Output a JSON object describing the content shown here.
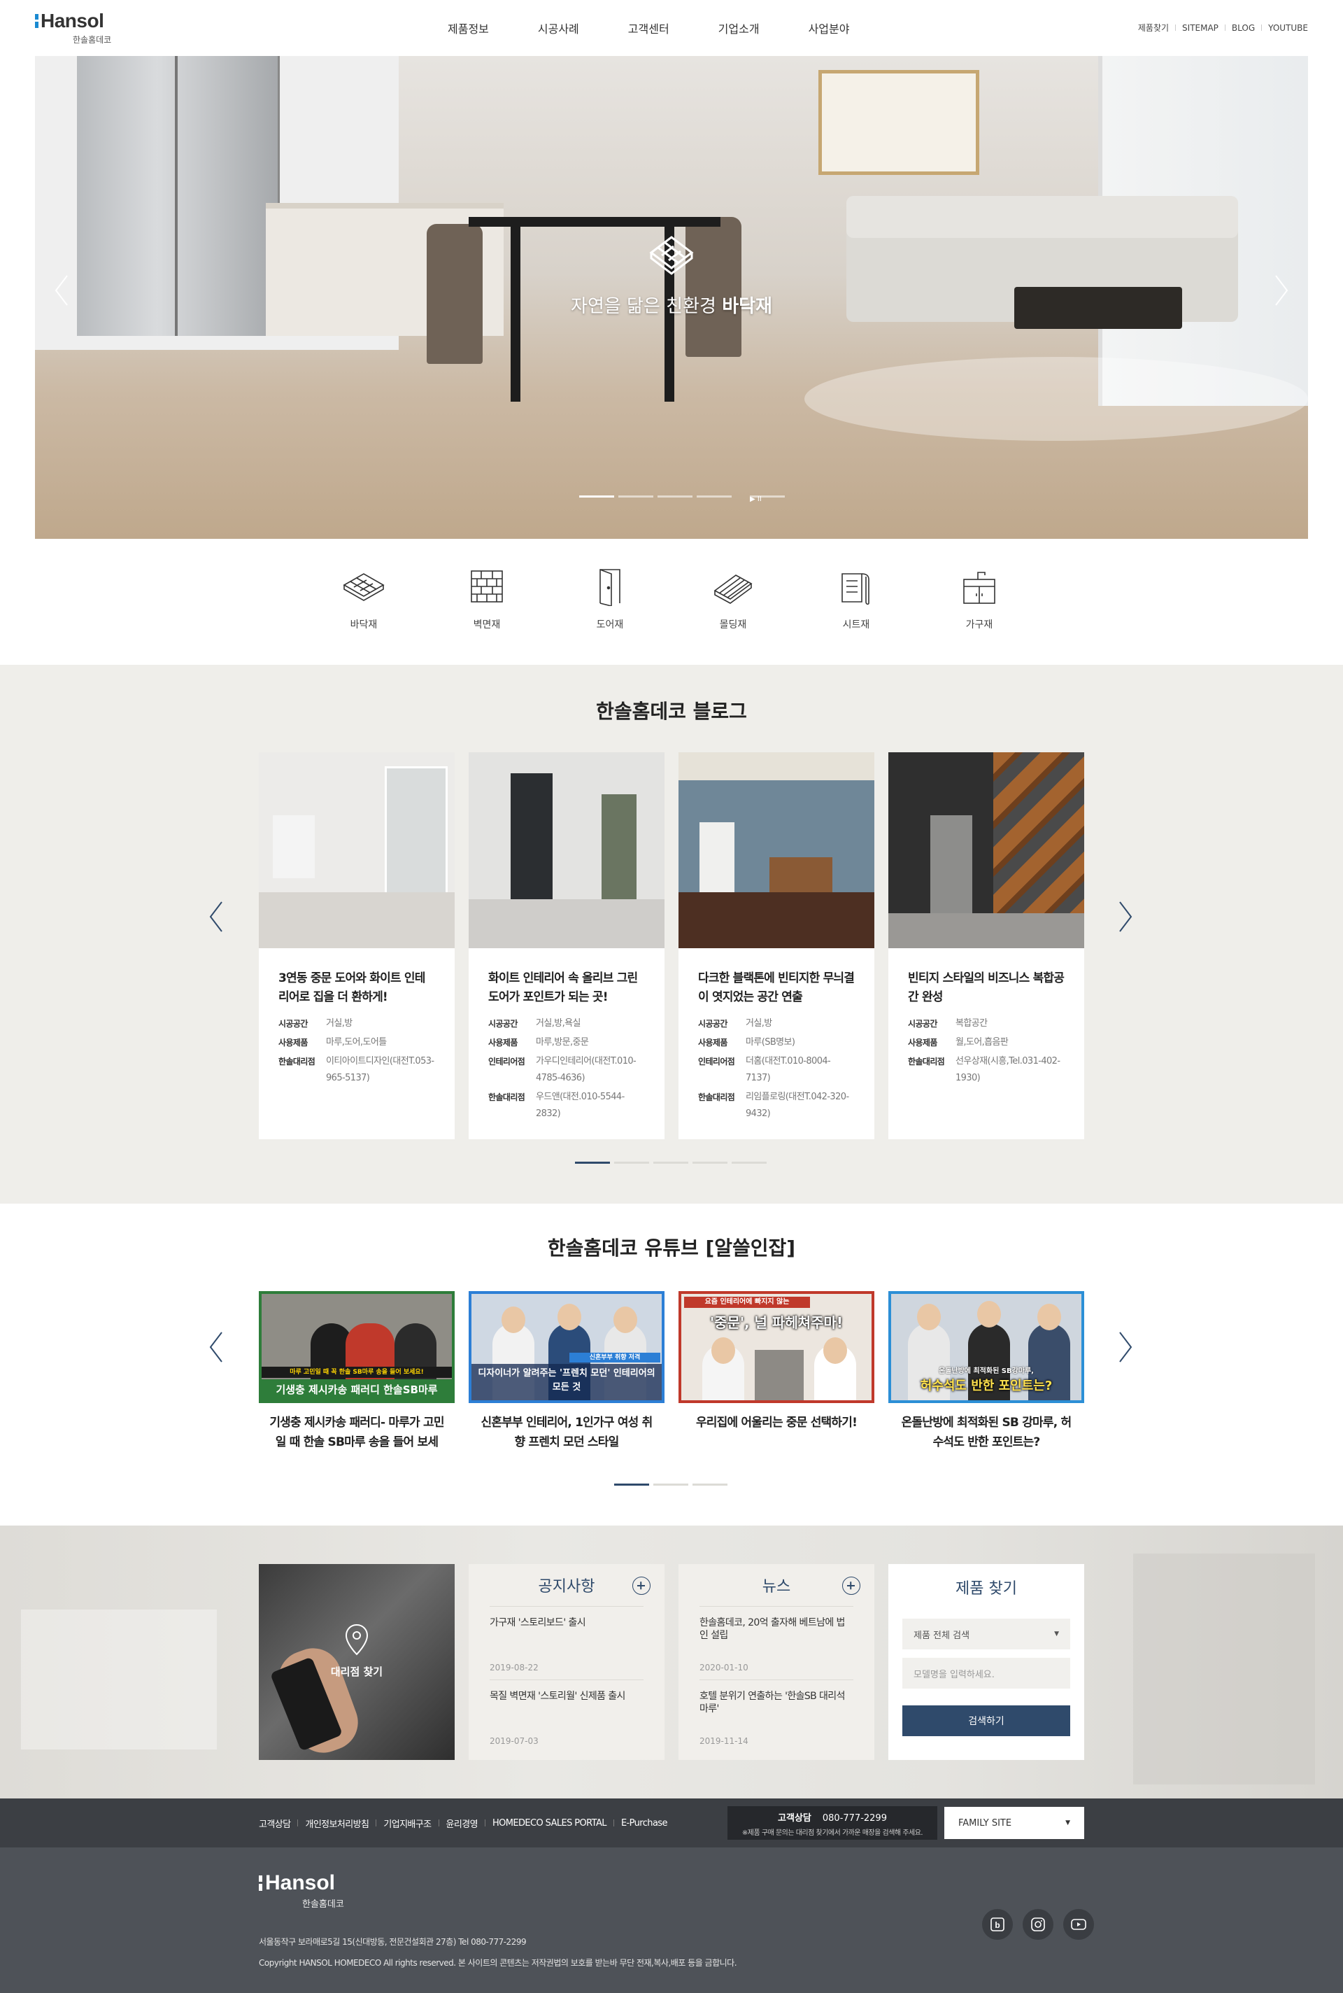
{
  "header": {
    "logo_text": "Hansol",
    "logo_sub": "한솔홈데코",
    "nav": [
      "제품정보",
      "시공사례",
      "고객센터",
      "기업소개",
      "사업분야"
    ],
    "util": [
      "제품찾기",
      "SITEMAP",
      "BLOG",
      "YOUTUBE"
    ]
  },
  "hero": {
    "caption_plain": "자연을 닮은 친환경 ",
    "caption_bold": "바닥재",
    "dots_total": 4,
    "dots_active": 1,
    "play_symbol": "▶ II"
  },
  "categories": [
    "바닥재",
    "벽면재",
    "도어재",
    "몰딩재",
    "시트재",
    "가구재"
  ],
  "blog": {
    "title": "한솔홈데코 블로그",
    "cards": [
      {
        "title": "3연동 중문 도어와 화이트 인테리어로 집을 더 환하게!",
        "rows": [
          {
            "k": "시공공간",
            "v": "거실,방"
          },
          {
            "k": "사용제품",
            "v": "마루,도어,도어틀"
          },
          {
            "k": "한솔대리점",
            "v": "이티아이트디자인(대전T.053-965-5137)"
          }
        ],
        "photo": {
          "bg": "#e6e6e4",
          "accent": "#ffffff"
        }
      },
      {
        "title": "화이트 인테리어 속 올리브 그린 도어가 포인트가 되는 곳!",
        "rows": [
          {
            "k": "시공공간",
            "v": "거실,방,욕실"
          },
          {
            "k": "사용제품",
            "v": "마루,방문,중문"
          },
          {
            "k": "인테리어점",
            "v": "가우디인테리어(대전T.010-4785-4636)"
          },
          {
            "k": "한솔대리점",
            "v": "우드앤(대전.010-5544-2832)"
          }
        ],
        "photo": {
          "bg": "#dedddb",
          "accent": "#5e6a54"
        }
      },
      {
        "title": "다크한 블랙톤에 빈티지한 무늬결이 엿지었는 공간 연출",
        "rows": [
          {
            "k": "시공공간",
            "v": "거실,방"
          },
          {
            "k": "사용제품",
            "v": "마루(SB명보)"
          },
          {
            "k": "인테리어점",
            "v": "더홈(대전T.010-8004-7137)"
          },
          {
            "k": "한솔대리점",
            "v": "리임플로링(대전T.042-320-9432)"
          }
        ],
        "photo": {
          "bg": "#6e8596",
          "accent": "#4a2e22"
        }
      },
      {
        "title": "빈티지 스타일의 비즈니스 복합공간 완성",
        "rows": [
          {
            "k": "시공공간",
            "v": "복합공간"
          },
          {
            "k": "사용제품",
            "v": "월,도어,흡음판"
          },
          {
            "k": "한솔대리점",
            "v": "선우상재(시흥,Tel.031-402-1930)"
          }
        ],
        "photo": {
          "bg": "#3b3b3b",
          "accent": "#9a5a2e"
        }
      }
    ],
    "dots_total": 5,
    "dots_active": 1
  },
  "youtube": {
    "title": "한솔홈데코 유튜브 [알쓸인잡]",
    "cards": [
      {
        "title": "기생충 제시카송 패러디- 마루가 고민일 때 한솔 SB마루 송을 들어 보세요!",
        "border": "#2e7d3a",
        "thumb_main": "기생충 제시카송 패러디 한솔SB마루",
        "thumb_sub": "마루 고민일 때 꼭 한솔 SB마루 송을 들어 보세요!"
      },
      {
        "title": "신혼부부 인테리어, 1인가구 여성 취향 프렌치 모던 스타일",
        "border": "#2c7fd6",
        "thumb_main": "디자이너가 알려주는 '프렌치 모던' 인테리어의 모든 것",
        "thumb_sub": "신혼부부 취향 저격"
      },
      {
        "title": "우리집에 어울리는 중문 선택하기!",
        "border": "#c0392b",
        "thumb_main": "'중문', 널 파헤쳐주마!",
        "thumb_sub": "요즘 인테리어에 빠지지 않는"
      },
      {
        "title": "온돌난방에 최적화된 SB 강마루, 허수석도 반한 포인트는?",
        "border": "#2c8fd6",
        "thumb_main": "허수석도 반한 포인트는?",
        "thumb_sub": "온돌난방에 최적화된 SB강마루,"
      }
    ],
    "dots_total": 3,
    "dots_active": 1
  },
  "info": {
    "agent_label": "대리점 찾기",
    "notice": {
      "title": "공지사항",
      "items": [
        {
          "t": "가구재 '스토리보드' 출시",
          "d": "2019-08-22"
        },
        {
          "t": "목질 벽면재 '스토리월' 신제품 출시",
          "d": "2019-07-03"
        }
      ]
    },
    "news": {
      "title": "뉴스",
      "items": [
        {
          "t": "한솔홈데코, 20억 출자해 베트남에 법인 설립",
          "d": "2020-01-10"
        },
        {
          "t": "호텔 분위기 연출하는 '한솔SB 대리석 마루'",
          "d": "2019-11-14"
        }
      ]
    },
    "finder": {
      "title": "제품 찾기",
      "select_value": "제품 전체 검색",
      "input_placeholder": "모델명을 입력하세요.",
      "button": "검색하기"
    }
  },
  "footer": {
    "links": [
      "고객상담",
      "개인정보처리방침",
      "기업지배구조",
      "윤리경영",
      "HOMEDECO SALES PORTAL",
      "E-Purchase"
    ],
    "call_label": "고객상담",
    "call_number": "080-777-2299",
    "call_note": "※제품 구매 문의는 대리점 찾기에서 가까운 매장을 검색해 주세요.",
    "family_site": "FAMILY SITE",
    "logo_text": "Hansol",
    "logo_sub": "한솔홈데코",
    "address": "서울동작구 보라매로5길 15(신대방동, 전문건설회관 27층)     Tel 080-777-2299",
    "copyright": "Copyright HANSOL HOMEDECO All rights reserved. 본 사이트의 콘텐츠는 저작권법의 보호를 받는바 무단 전재,복사,배포 등을 금합니다.",
    "sns": [
      "blog-icon",
      "instagram-icon",
      "youtube-icon"
    ]
  }
}
